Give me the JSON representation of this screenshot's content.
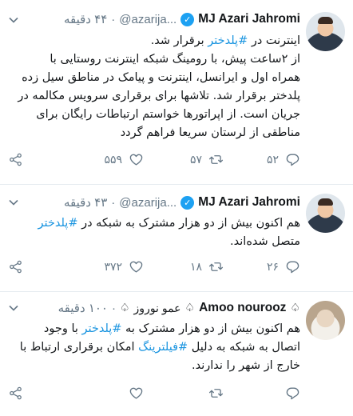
{
  "tweets": [
    {
      "name": "MJ Azari Jahromi",
      "handle": "@azarija...",
      "time": "۴۴ دقیقه",
      "body_lines": [
        [
          "اینترنت در ",
          "#پلدختر",
          " برقرار شد."
        ],
        [
          "از ۲ساعت پیش، با رومینگ شبکه اینترنت روستایی با"
        ],
        [
          "همراه اول و ایرانسل، اینترنت و پیامک در مناطق سیل زده"
        ],
        [
          "پلدختر برقرار شد. تلاشها برای برقراری سرویس مکالمه در"
        ],
        [
          "جریان است. از اپراتورها خواستم ارتباطات رایگان برای"
        ],
        [
          "مناطقی از لرستان سریعا فراهم گردد"
        ]
      ],
      "replies": "۵۲",
      "retweets": "۵۷",
      "likes": "۵۵۹"
    },
    {
      "name": "MJ Azari Jahromi",
      "handle": "@azarija...",
      "time": "۴۳ دقیقه",
      "body_lines": [
        [
          "هم اکنون بیش از دو هزار مشترک به شبکه در ",
          "#پلدختر"
        ],
        [
          "متصل شده‌اند."
        ]
      ],
      "replies": "۲۶",
      "retweets": "۱۸",
      "likes": "۳۷۲"
    },
    {
      "name": "Amoo nourooz",
      "name_fa": "عمو نوروز",
      "handle": "",
      "time": "۱۰۰ دقیقه",
      "body_lines": [
        [
          "هم اکنون بیش از دو هزار مشترک به ",
          "#پلدختر",
          " با وجود"
        ],
        [
          "اتصال به شبکه به دلیل ",
          "#فیلترینگ",
          " امکان برقراری ارتباط با"
        ],
        [
          "خارج از شهر را ندارند."
        ]
      ],
      "replies": "",
      "retweets": "",
      "likes": ""
    }
  ],
  "colors": {
    "hashtag": "#1b95e0",
    "verified": "#1da1f2",
    "muted": "#657786",
    "divider": "#e6ecf0"
  },
  "icons": {
    "reply": "reply-icon",
    "retweet": "retweet-icon",
    "like": "heart-icon",
    "share": "share-icon",
    "more": "chevron-down-icon",
    "verified": "verified-badge-icon"
  }
}
